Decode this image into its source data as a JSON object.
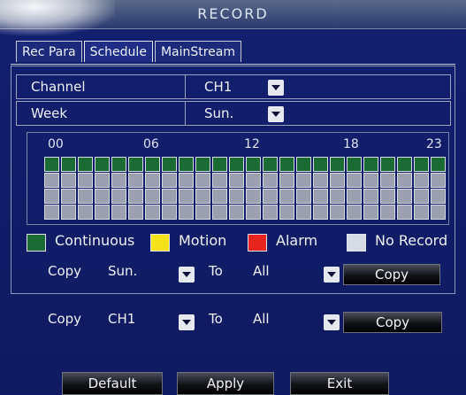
{
  "window": {
    "title": "RECORD"
  },
  "tabs": [
    {
      "label": "Rec Para",
      "active": false
    },
    {
      "label": "Schedule",
      "active": true
    },
    {
      "label": "MainStream",
      "active": false
    }
  ],
  "fields": {
    "channel": {
      "label": "Channel",
      "value": "CH1"
    },
    "week": {
      "label": "Week",
      "value": "Sun."
    }
  },
  "schedule": {
    "hour_labels": [
      "00",
      "06",
      "12",
      "18",
      "23"
    ],
    "rows": [
      {
        "mode": "Continuous"
      },
      {
        "mode": "No Record"
      },
      {
        "mode": "No Record"
      },
      {
        "mode": "No Record"
      }
    ]
  },
  "legend": {
    "continuous": {
      "label": "Continuous",
      "color": "#1c6b34"
    },
    "motion": {
      "label": "Motion",
      "color": "#f5e21a"
    },
    "alarm": {
      "label": "Alarm",
      "color": "#e8241e"
    },
    "no_record": {
      "label": "No Record",
      "color": "#d7dbe4"
    }
  },
  "copy_week": {
    "copy_label": "Copy",
    "from": "Sun.",
    "to_label": "To",
    "to": "All",
    "button": "Copy"
  },
  "copy_channel": {
    "copy_label": "Copy",
    "from": "CH1",
    "to_label": "To",
    "to": "All",
    "button": "Copy"
  },
  "footer": {
    "default": "Default",
    "apply": "Apply",
    "exit": "Exit"
  }
}
